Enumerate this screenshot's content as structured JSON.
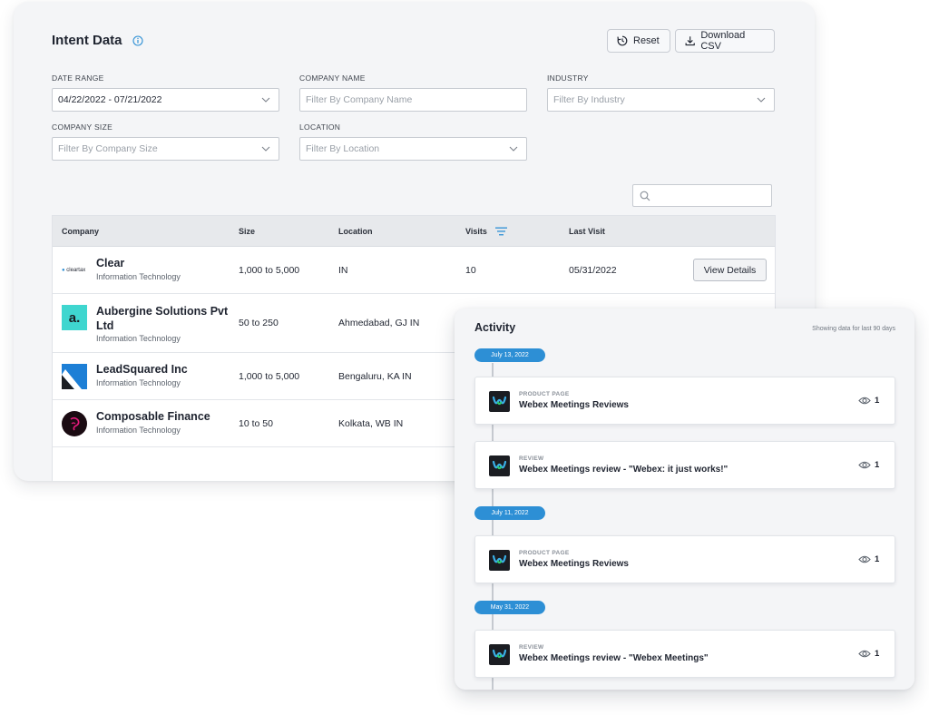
{
  "intent": {
    "title": "Intent Data",
    "reset_label": "Reset",
    "download_label": "Download CSV",
    "filters": {
      "date_range": {
        "label": "DATE RANGE",
        "value": "04/22/2022 - 07/21/2022"
      },
      "company_name": {
        "label": "COMPANY NAME",
        "placeholder": "Filter By Company Name"
      },
      "industry": {
        "label": "INDUSTRY",
        "placeholder": "Filter By Industry"
      },
      "company_size": {
        "label": "COMPANY SIZE",
        "placeholder": "Filter By Company Size"
      },
      "location": {
        "label": "LOCATION",
        "placeholder": "Filter By Location"
      }
    },
    "table": {
      "headers": [
        "Company",
        "Size",
        "Location",
        "Visits",
        "Last Visit"
      ],
      "rows": [
        {
          "company": "Clear",
          "logo_text": "cleartax",
          "industry": "Information Technology",
          "size": "1,000 to 5,000",
          "location": "IN",
          "visits": "10",
          "last_visit": "05/31/2022",
          "action": "View Details"
        },
        {
          "company": "Aubergine Solutions Pvt Ltd",
          "logo_text": "a.",
          "industry": "Information Technology",
          "size": "50 to 250",
          "location": "Ahmedabad, GJ IN"
        },
        {
          "company": "LeadSquared Inc",
          "industry": "Information Technology",
          "size": "1,000 to 5,000",
          "location": "Bengaluru, KA IN"
        },
        {
          "company": "Composable Finance",
          "industry": "Information Technology",
          "size": "10 to 50",
          "location": "Kolkata, WB IN"
        }
      ]
    }
  },
  "activity": {
    "title": "Activity",
    "note": "Showing data for last 90 days",
    "dates": [
      "July 13, 2022",
      "July 11, 2022",
      "May 31, 2022"
    ],
    "items": [
      {
        "kind": "PRODUCT PAGE",
        "title": "Webex Meetings Reviews",
        "views": "1"
      },
      {
        "kind": "REVIEW",
        "title": "Webex Meetings review - \"Webex: it just works!\"",
        "views": "1"
      },
      {
        "kind": "PRODUCT PAGE",
        "title": "Webex Meetings Reviews",
        "views": "1"
      },
      {
        "kind": "REVIEW",
        "title": "Webex Meetings review - \"Webex Meetings\"",
        "views": "1"
      }
    ]
  },
  "colors": {
    "accent": "#2d8fd5",
    "panel_bg": "#f4f5f7",
    "aubergine": "#3fd6cf",
    "leadsquared": "#1d7fd6",
    "composable": "#e8197d"
  },
  "icons": [
    "info-icon",
    "reset-icon",
    "download-icon",
    "chevron-down-icon",
    "search-icon",
    "sort-icon",
    "webex-icon",
    "eye-icon"
  ]
}
